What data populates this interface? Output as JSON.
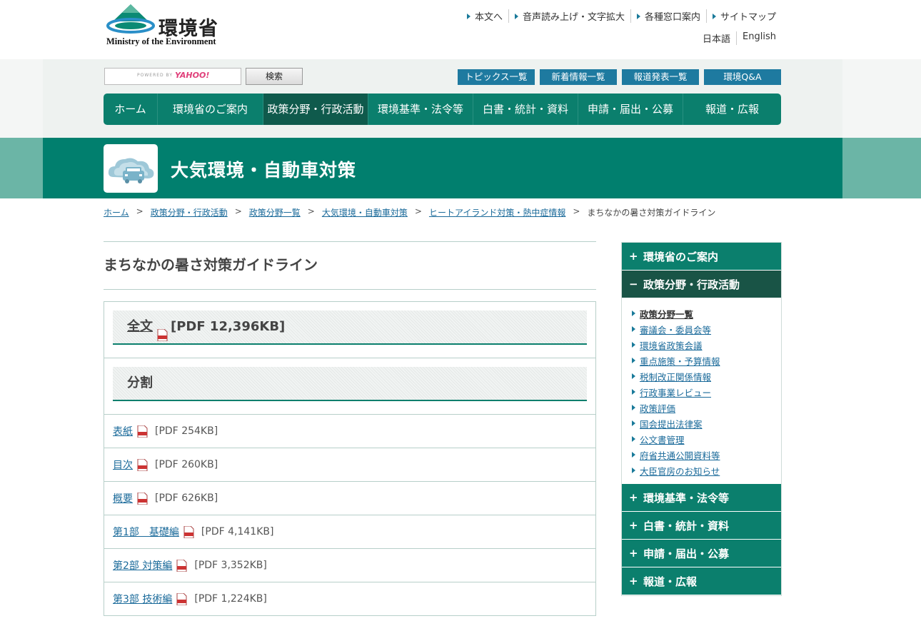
{
  "header": {
    "logo_text": "環境省",
    "logo_en": "Ministry of the Environment",
    "util_links": [
      "本文へ",
      "音声読み上げ・文字拡大",
      "各種窓口案内",
      "サイトマップ"
    ],
    "lang_links": [
      "日本語",
      "English"
    ]
  },
  "search": {
    "powered_by": "POWERED BY",
    "brand": "YAHOO!",
    "button_label": "検索",
    "placeholder": ""
  },
  "quick_links": [
    "トピックス一覧",
    "新着情報一覧",
    "報道発表一覧",
    "環境Q&A"
  ],
  "global_nav": [
    {
      "label": "ホーム",
      "active": false
    },
    {
      "label": "環境省のご案内",
      "active": false
    },
    {
      "label": "政策分野・行政活動",
      "active": true
    },
    {
      "label": "環境基準・法令等",
      "active": false
    },
    {
      "label": "白書・統計・資料",
      "active": false
    },
    {
      "label": "申請・届出・公募",
      "active": false
    },
    {
      "label": "報道・広報",
      "active": false
    }
  ],
  "category": {
    "title": "大気環境・自動車対策",
    "icon": "cloud-car-icon"
  },
  "breadcrumb": {
    "links": [
      "ホーム",
      "政策分野・行政活動",
      "政策分野一覧",
      "大気環境・自動車対策",
      "ヒートアイランド対策・熱中症情報"
    ],
    "current": "まちなかの暑さ対策ガイドライン",
    "separator": ">"
  },
  "main": {
    "page_title": "まちなかの暑さ対策ガイドライン",
    "full_text": {
      "label": "全文",
      "size": "[PDF 12,396KB]"
    },
    "split_heading": "分割",
    "documents": [
      {
        "label": "表紙",
        "size": "[PDF 254KB]"
      },
      {
        "label": "目次",
        "size": "[PDF 260KB]"
      },
      {
        "label": "概要",
        "size": "[PDF 626KB]"
      },
      {
        "label": "第1部　基礎編",
        "size": "[PDF 4,141KB]"
      },
      {
        "label": "第2部 対策編",
        "size": "[PDF 3,352KB]"
      },
      {
        "label": "第3部 技術編",
        "size": "[PDF 1,224KB]"
      }
    ]
  },
  "sidebar": {
    "sections": [
      {
        "label": "環境省のご案内",
        "sign": "+"
      },
      {
        "label": "政策分野・行政活動",
        "sign": "−"
      },
      {
        "label": "環境基準・法令等",
        "sign": "+"
      },
      {
        "label": "白書・統計・資料",
        "sign": "+"
      },
      {
        "label": "申請・届出・公募",
        "sign": "+"
      },
      {
        "label": "報道・広報",
        "sign": "+"
      }
    ],
    "sub_items": [
      "政策分野一覧",
      "審議会・委員会等",
      "環境省政策会議",
      "重点施策・予算情報",
      "税制改正関係情報",
      "行政事業レビュー",
      "政策評価",
      "国会提出法律案",
      "公文書管理",
      "府省共通公開資料等",
      "大臣官房のお知らせ"
    ]
  },
  "colors": {
    "brand_green": "#0b7f6d",
    "active_green": "#0f5a4c",
    "link_blue": "#1a6a9a",
    "quick_link_blue": "#1e7aa0"
  }
}
